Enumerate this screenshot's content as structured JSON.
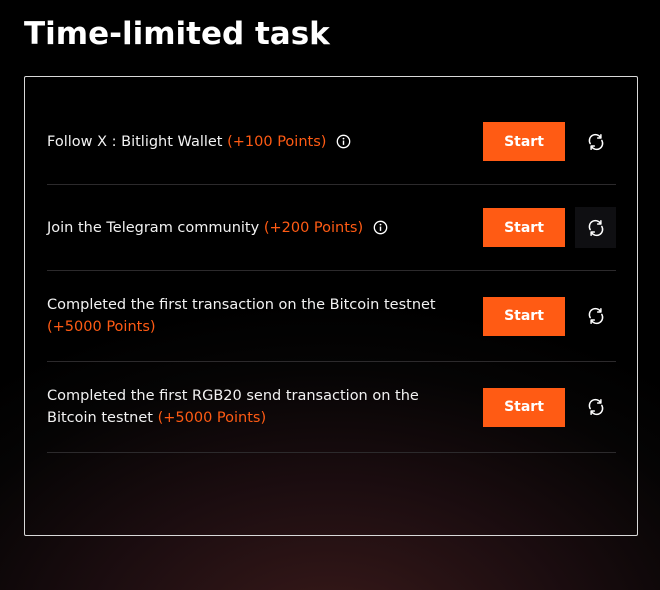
{
  "page": {
    "title": "Time-limited task"
  },
  "tasks": [
    {
      "text": "Follow X : Bitlight Wallet",
      "points": "(+100 Points)",
      "has_info": true,
      "start_label": "Start"
    },
    {
      "text": "Join the Telegram community",
      "points": "(+200 Points)",
      "has_info": true,
      "start_label": "Start"
    },
    {
      "text": "Completed the first transaction on the Bitcoin testnet",
      "points": "(+5000 Points)",
      "has_info": false,
      "start_label": "Start"
    },
    {
      "text": "Completed the first RGB20 send transaction on the Bitcoin testnet",
      "points": "(+5000 Points)",
      "has_info": false,
      "start_label": "Start"
    }
  ],
  "icons": {
    "info": "info-icon",
    "refresh": "refresh-icon"
  },
  "colors": {
    "accent": "#ff5b14",
    "border": "#d9d9d9",
    "divider": "#2c2a2c"
  }
}
